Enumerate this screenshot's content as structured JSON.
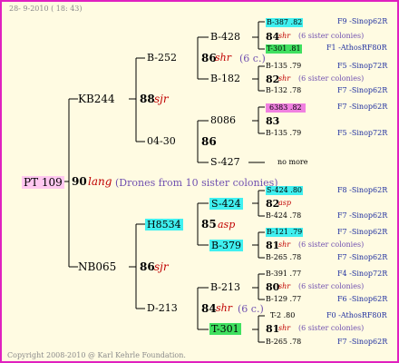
{
  "header": "28- 9-2010 ( 18: 43)",
  "footer": "Copyright 2008-2010 @ Karl Kehrle Foundation.",
  "colors": {
    "border": "#e020c0",
    "background": "#fffbe2",
    "cyan": "#40f0f0",
    "green": "#40e060",
    "magenta": "#f080e0",
    "pink": "#ffc8f0"
  },
  "root": {
    "id": "PT 109",
    "num": "90",
    "breeder": "lang",
    "note": "(Drones from 10 sister colonies)"
  },
  "g1": [
    {
      "id": "KB244",
      "num": "88",
      "breeder": "sjr"
    },
    {
      "id": "NB065",
      "num": "86",
      "breeder": "sjr"
    }
  ],
  "g2": [
    {
      "id": "B-252",
      "num": "86",
      "breeder": "shr",
      "note": "(6 c.)"
    },
    {
      "id": "04-30",
      "num": "86",
      "breeder": "",
      "note": ""
    },
    {
      "id": "H8534",
      "num": "85",
      "breeder": "asp",
      "note": ""
    },
    {
      "id": "D-213",
      "num": "84",
      "breeder": "shr",
      "note": "(6 c.)"
    }
  ],
  "g3": [
    {
      "id": "B-428"
    },
    {
      "id": "B-182"
    },
    {
      "id": "8086"
    },
    {
      "id": "S-427"
    },
    {
      "id": "S-424"
    },
    {
      "id": "B-379"
    },
    {
      "id": "B-213"
    },
    {
      "id": "T-301"
    }
  ],
  "g4": [
    {
      "id": "B-387 .82",
      "code": "F9 -Sinop62R"
    },
    {
      "num": "84",
      "breeder": "shr",
      "note": "(6 sister colonies)"
    },
    {
      "id": "T-301 .81",
      "code": "F1 -AthosRF80R"
    },
    {
      "id": "B-135 .79",
      "code": "F5 -Sinop72R"
    },
    {
      "num": "82",
      "breeder": "shr",
      "note": "(6 sister colonies)"
    },
    {
      "id": "B-132 .78",
      "code": "F7 -Sinop62R"
    },
    {
      "id": "6383 .82",
      "code": "F7 -Sinop62R"
    },
    {
      "num": "83"
    },
    {
      "id": "B-135 .79",
      "code": "F5 -Sinop72R"
    },
    {
      "text": "no more"
    },
    {
      "id": "S-424 .80",
      "code": "F8 -Sinop62R"
    },
    {
      "num": "82",
      "breeder": "asp"
    },
    {
      "id": "B-424 .78",
      "code": "F7 -Sinop62R"
    },
    {
      "id": "B-121 .79",
      "code": "F7 -Sinop62R"
    },
    {
      "num": "81",
      "breeder": "shr",
      "note": "(6 sister colonies)"
    },
    {
      "id": "B-265 .78",
      "code": "F7 -Sinop62R"
    },
    {
      "id": "B-391 .77",
      "code": "F4 -Sinop72R"
    },
    {
      "num": "80",
      "breeder": "shr",
      "note": "(6 sister colonies)"
    },
    {
      "id": "B-129 .77",
      "code": "F6 -Sinop62R"
    },
    {
      "id": "T-2 .80",
      "code": "F0 -AthosRF80R"
    },
    {
      "num": "81",
      "breeder": "shr",
      "note": "(6 sister colonies)"
    },
    {
      "id": "B-265 .78",
      "code": "F7 -Sinop62R"
    }
  ]
}
